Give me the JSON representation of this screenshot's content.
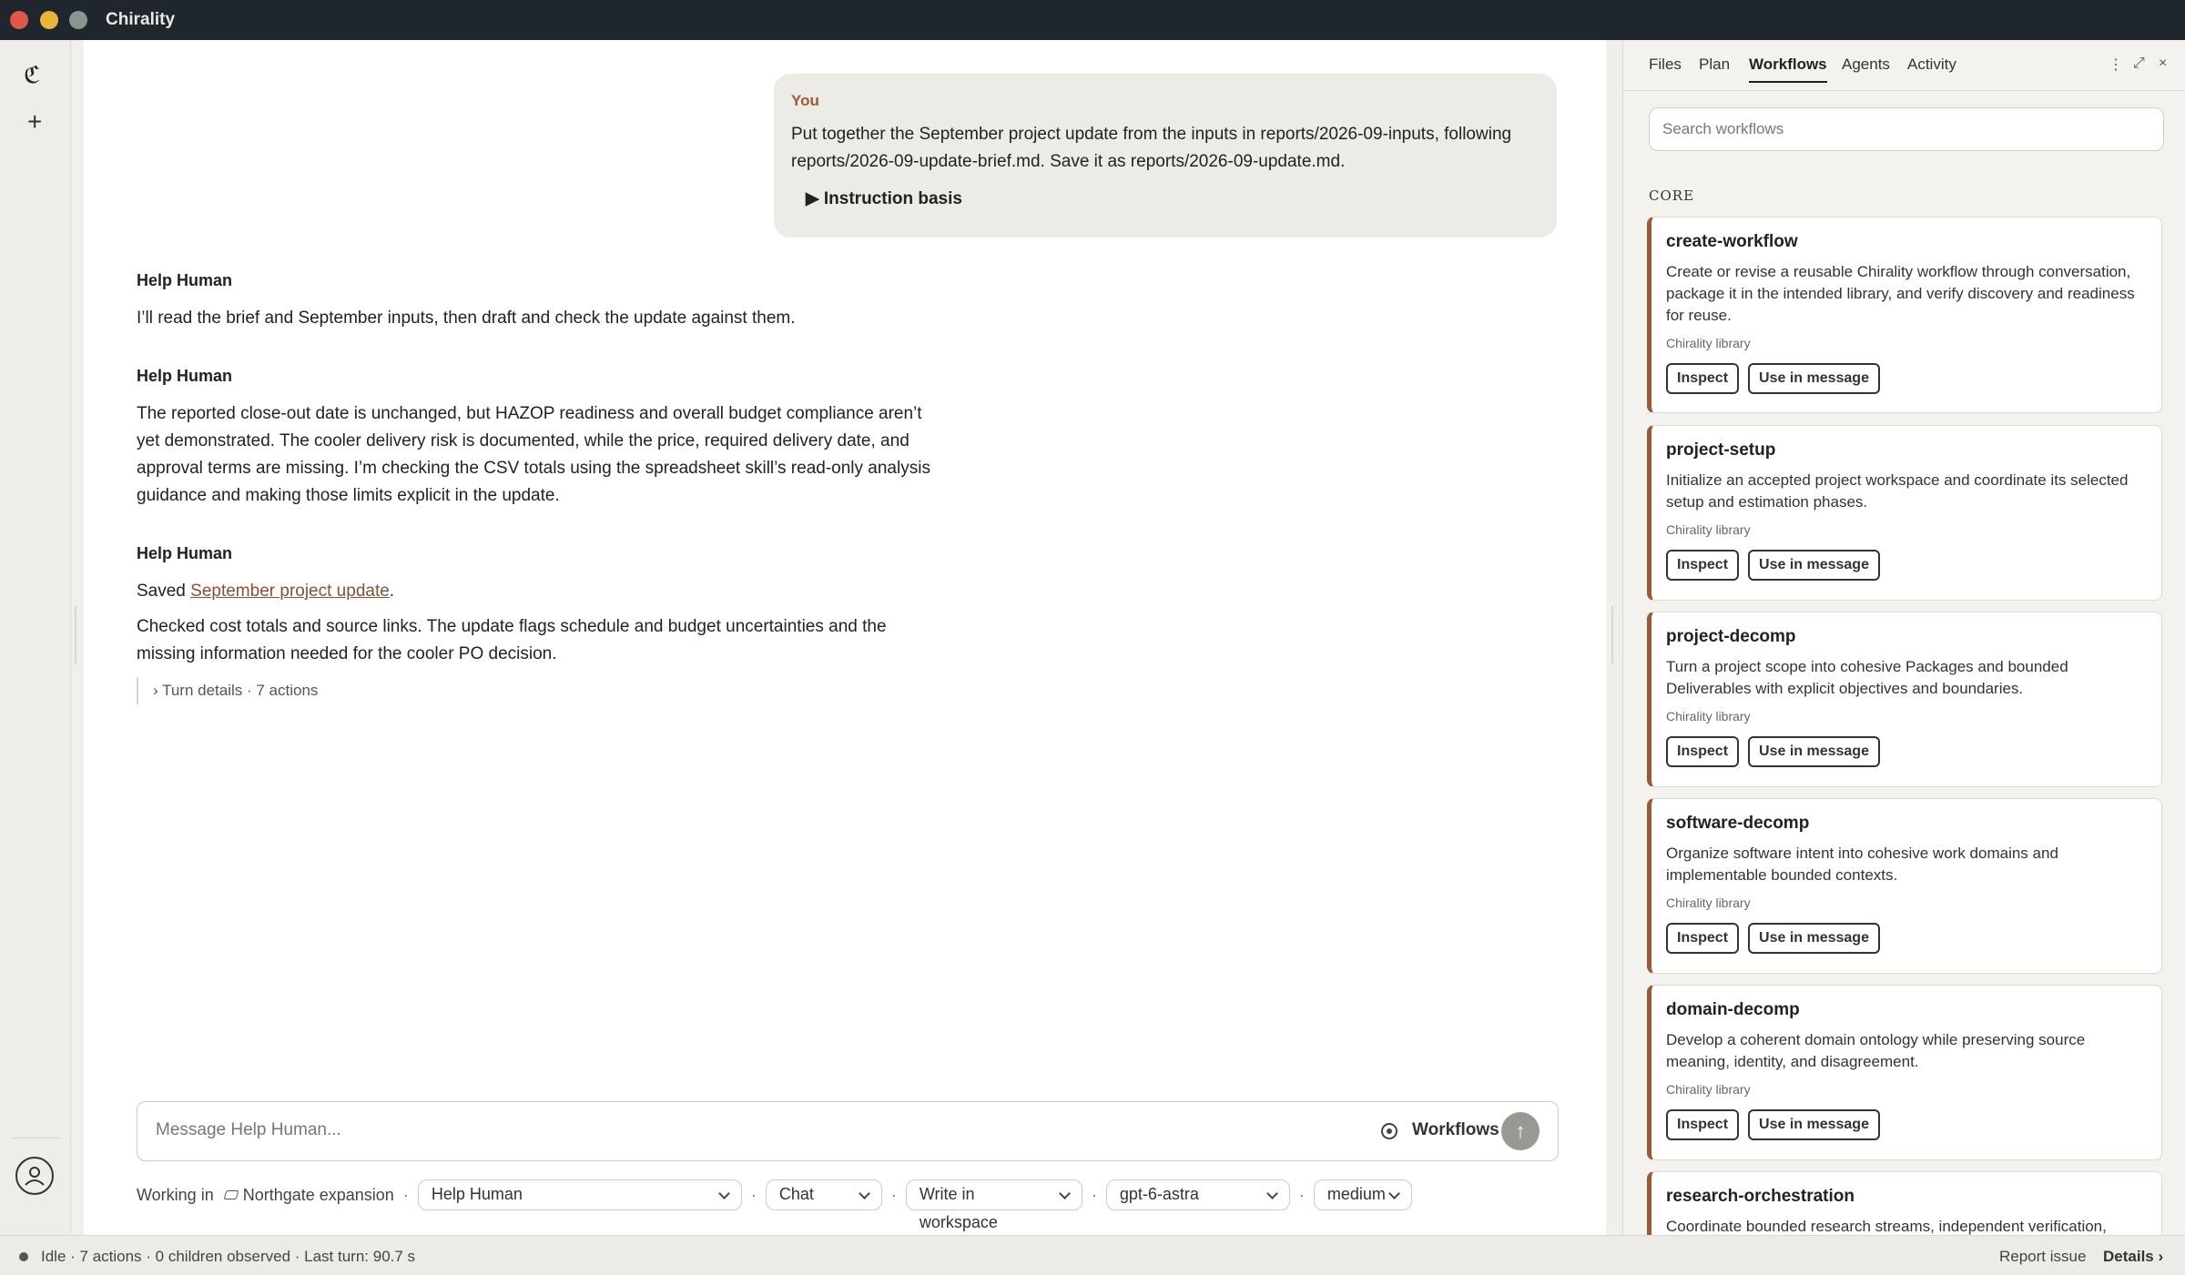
{
  "app": {
    "title": "Chirality"
  },
  "rail": {
    "logo": "ℭ",
    "new": "+"
  },
  "chat": {
    "user_message": {
      "who": "You",
      "text": "Put together the September project update from the inputs in reports/2026-09-inputs, following reports/2026-09-update-brief.md. Save it as reports/2026-09-update.md.",
      "basis": "▶ Instruction basis"
    },
    "assistant": [
      {
        "who": "Help Human",
        "text": "I’ll read the brief and September inputs, then draft and check the update against them."
      },
      {
        "who": "Help Human",
        "text": "The reported close-out date is unchanged, but HAZOP readiness and overall budget compliance aren’t yet demonstrated. The cooler delivery risk is documented, while the price, required delivery date, and approval terms are missing. I’m checking the CSV totals using the spreadsheet skill’s read-only analysis guidance and making those limits explicit in the update."
      },
      {
        "who": "Help Human",
        "saved_prefix": "Saved ",
        "saved_link": "September project update",
        "saved_suffix": ".",
        "text": "Checked cost totals and source links. The update flags schedule and budget uncertainties and the missing information needed for the cooler PO decision.",
        "turn_details": "› Turn details · 7 actions"
      }
    ]
  },
  "composer": {
    "placeholder": "Message Help Human...",
    "workflows_label": "Workflows",
    "send_icon": "↑"
  },
  "context": {
    "working_in_label": "Working in",
    "workspace": "Northgate expansion",
    "agent": "Help Human",
    "mode": "Chat",
    "permission": "Write in workspace",
    "model": "gpt-6-astra",
    "effort": "medium",
    "separator": "·"
  },
  "panel": {
    "tabs": [
      "Files",
      "Plan",
      "Workflows",
      "Agents",
      "Activity"
    ],
    "active_tab": "Workflows",
    "controls": {
      "more": "⋮",
      "expand": "⤢",
      "close": "×"
    },
    "search_placeholder": "Search workflows",
    "section": "CORE",
    "inspect_label": "Inspect",
    "use_label": "Use in message",
    "workflows": [
      {
        "name": "create-workflow",
        "description": "Create or revise a reusable Chirality workflow through conversation, package it in the intended library, and verify discovery and readiness for reuse.",
        "library": "Chirality library"
      },
      {
        "name": "project-setup",
        "description": "Initialize an accepted project workspace and coordinate its selected setup and estimation phases.",
        "library": "Chirality library"
      },
      {
        "name": "project-decomp",
        "description": "Turn a project scope into cohesive Packages and bounded Deliverables with explicit objectives and boundaries.",
        "library": "Chirality library"
      },
      {
        "name": "software-decomp",
        "description": "Organize software intent into cohesive work domains and implementable bounded contexts.",
        "library": "Chirality library"
      },
      {
        "name": "domain-decomp",
        "description": "Develop a coherent domain ontology while preserving source meaning, identity, and disagreement.",
        "library": "Chirality library"
      },
      {
        "name": "research-orchestration",
        "description": "Coordinate bounded research streams, independent verification,",
        "library": ""
      }
    ]
  },
  "statusbar": {
    "text": "Idle · 7 actions · 0 children observed · Last turn: 90.7 s",
    "report": "Report issue",
    "details": "Details ›"
  }
}
